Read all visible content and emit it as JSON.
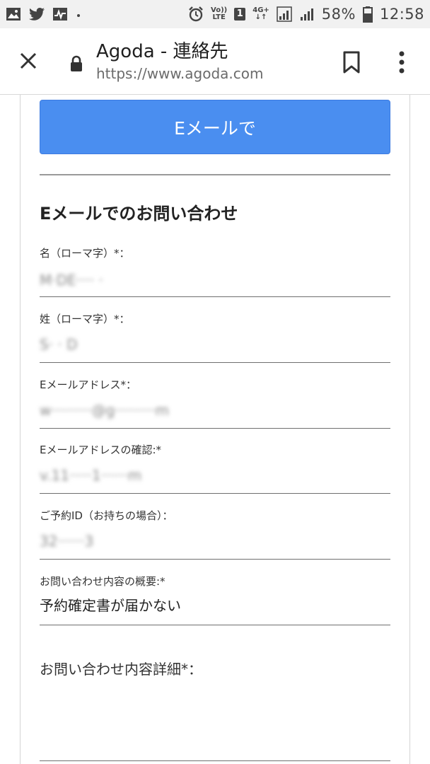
{
  "status_bar": {
    "volte_top": "Vo))",
    "volte_bottom": "LTE",
    "sim_slot": "1",
    "network_top": "4G+",
    "network_bottom": "↓↑",
    "battery_percent": "58%",
    "time": "12:58"
  },
  "browser": {
    "page_title": "Agoda - 連絡先",
    "url": "https://www.agoda.com"
  },
  "contact": {
    "email_button_label": "Eメールで",
    "section_title": "Eメールでのお問い合わせ"
  },
  "form": {
    "fields": [
      {
        "label": "名（ローマ字）*：",
        "value": "M·DE···· ·",
        "obscured": true
      },
      {
        "label": "姓（ローマ字）*：",
        "value": "S· · D",
        "obscured": true
      },
      {
        "label": "Eメールアドレス*：",
        "value": "w·········@g·········m",
        "obscured": true
      },
      {
        "label": "Eメールアドレスの確認:*",
        "value": "v.11·····1······m",
        "obscured": true
      },
      {
        "label": "ご予約ID（お持ちの場合）：",
        "value": "32······3",
        "obscured": true
      },
      {
        "label": "お問い合わせ内容の概要:*",
        "value": "予約確定書が届かない",
        "obscured": false
      }
    ],
    "details_label": "お問い合わせ内容詳細*："
  },
  "colors": {
    "accent_button": "#4a8ef0",
    "status_bar_bg": "#f1f1f1"
  }
}
